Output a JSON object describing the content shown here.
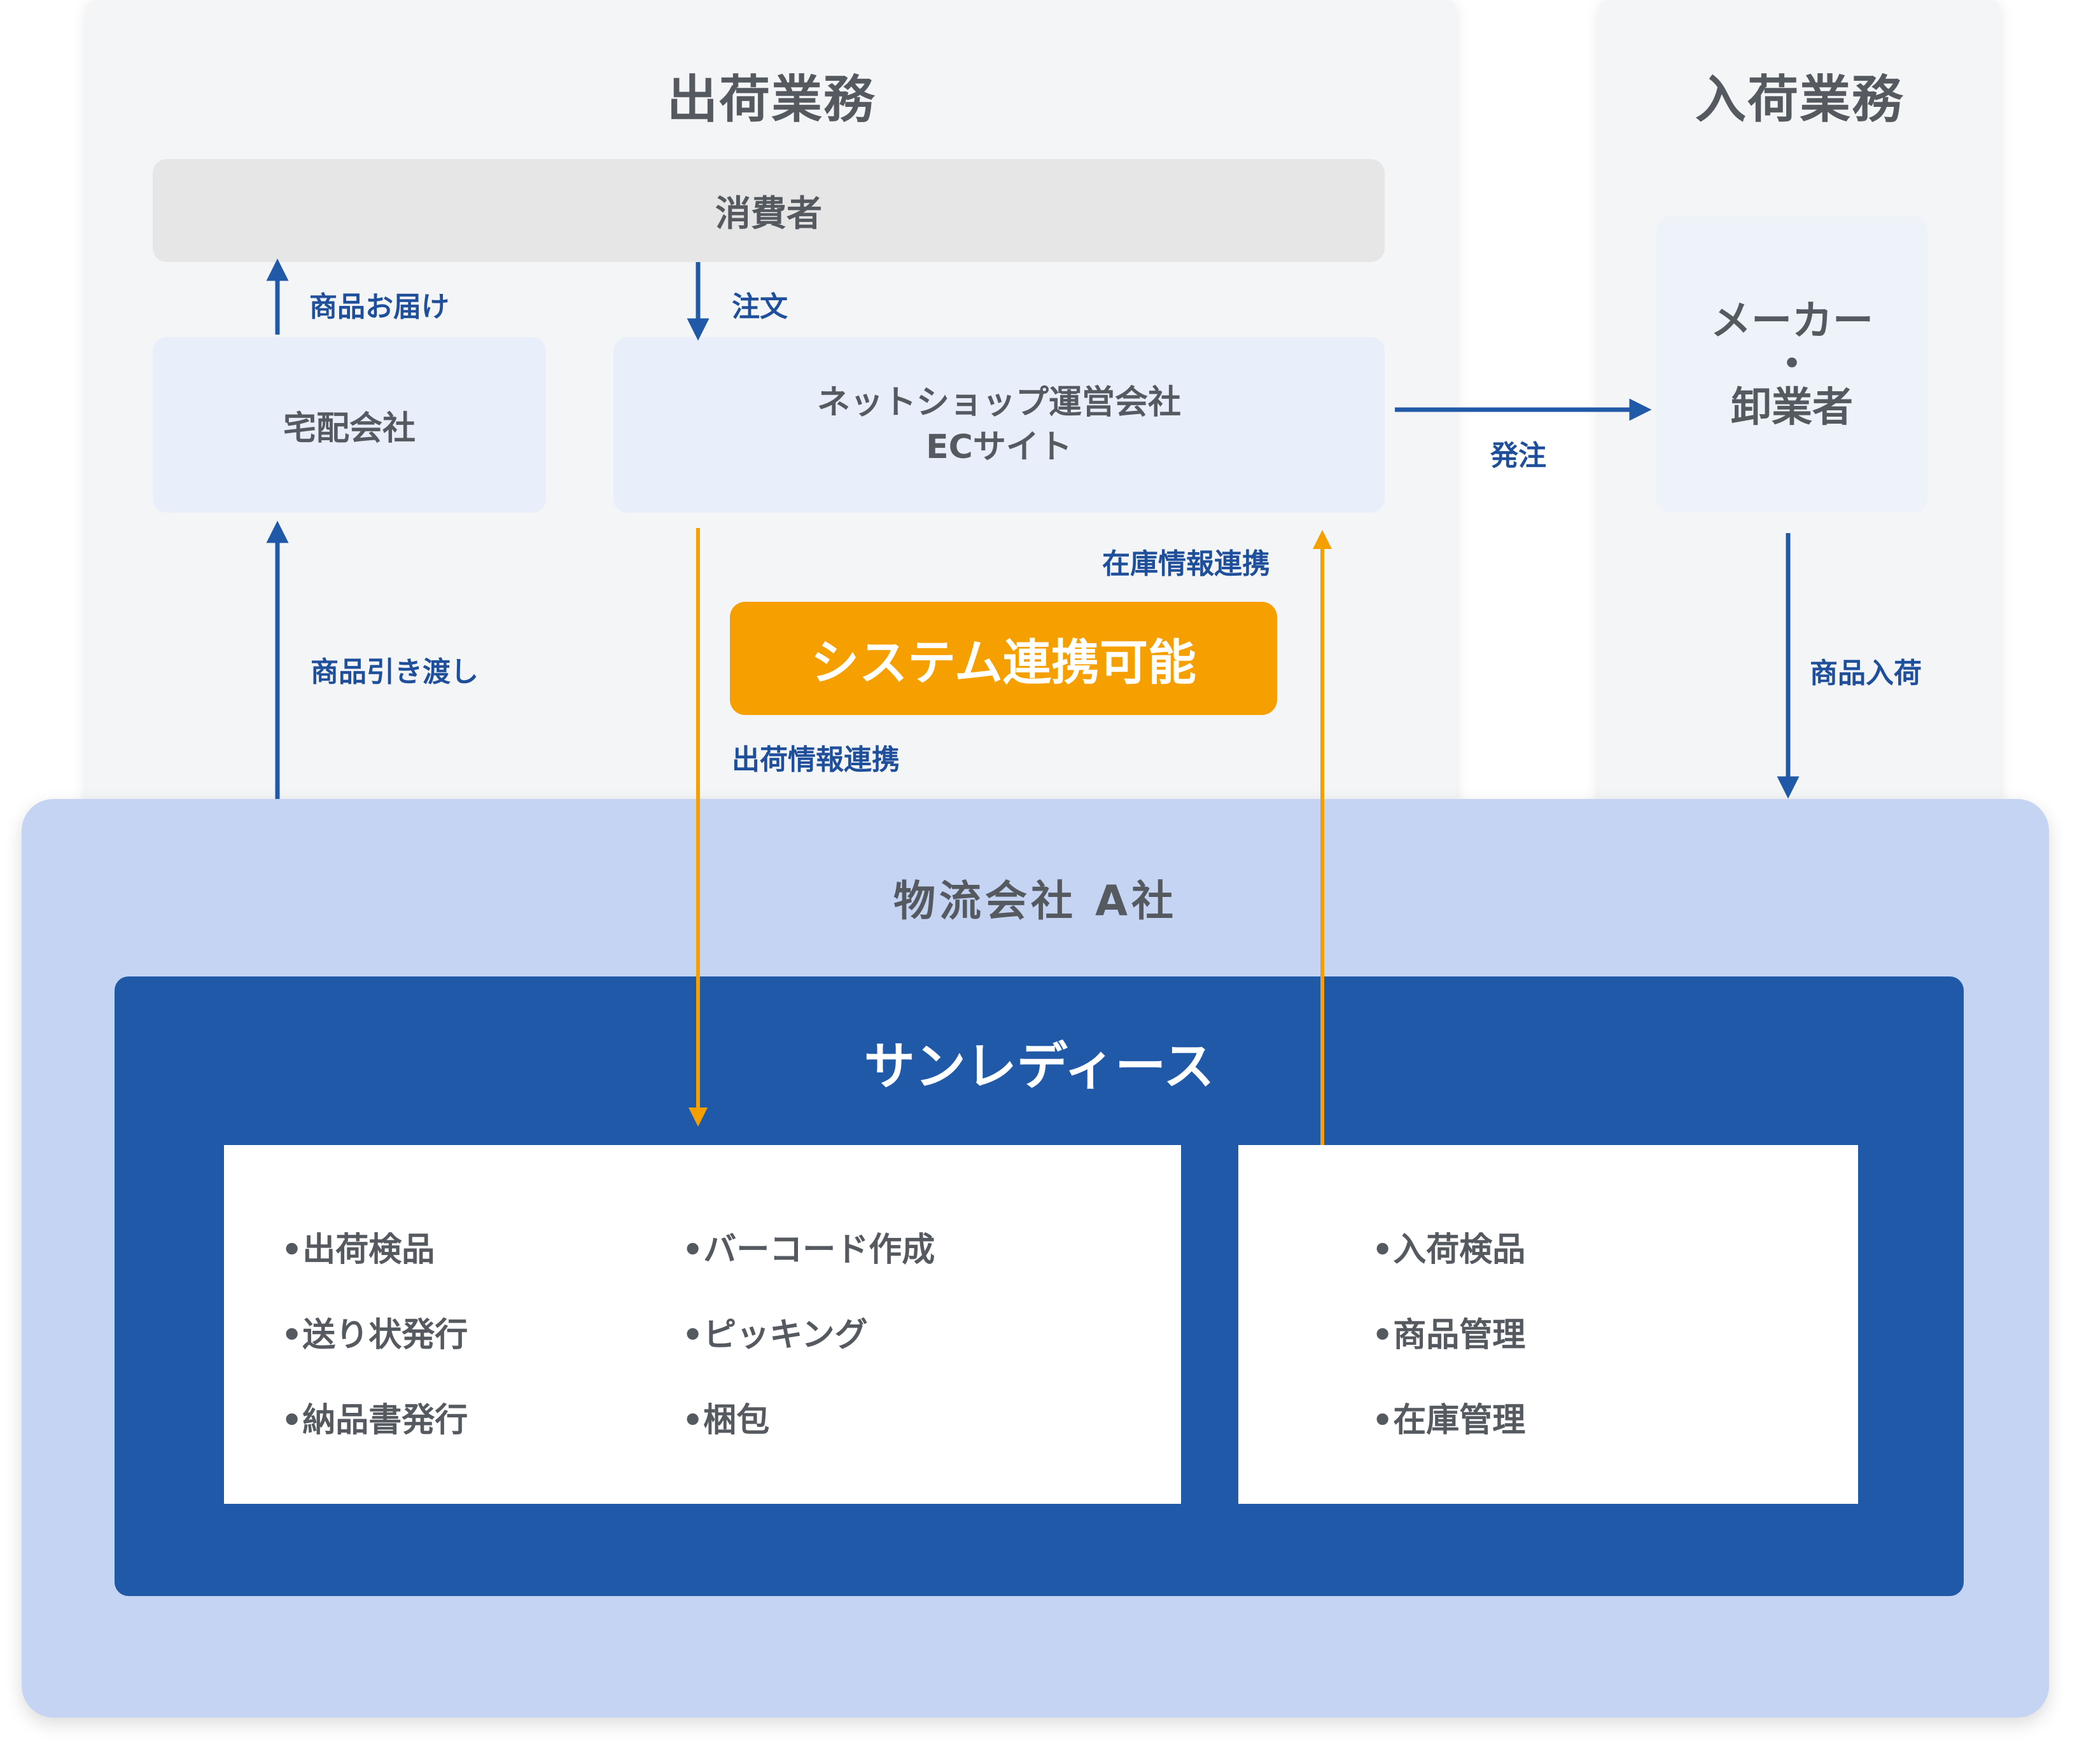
{
  "outbound": {
    "title": "出荷業務"
  },
  "inbound": {
    "title": "入荷業務"
  },
  "consumer": {
    "label": "消費者"
  },
  "courier": {
    "label": "宅配会社"
  },
  "shop": {
    "line1": "ネットショップ運営会社",
    "line2": "ECサイト"
  },
  "maker": {
    "line1": "メーカー",
    "dot": "・",
    "line2": "卸業者"
  },
  "labels": {
    "delivery": "商品お届け",
    "order": "注文",
    "purchase_order": "発注",
    "handover": "商品引き渡し",
    "stock_sync": "在庫情報連携",
    "shipping_sync": "出荷情報連携",
    "arrival": "商品入荷"
  },
  "system_badge": "システム連携可能",
  "logistics": {
    "title": "物流会社 A社"
  },
  "sunladys": {
    "title": "サンレディース",
    "outbound_col1": [
      "•出荷検品",
      "•送り状発行",
      "•納品書発行"
    ],
    "outbound_col2": [
      "•バーコード作成",
      "•ピッキング",
      "•梱包"
    ],
    "inbound_items": [
      "•入荷検品",
      "•商品管理",
      "•在庫管理"
    ]
  },
  "colors": {
    "blue_arrow": "#2059a8",
    "orange_arrow": "#f5a000",
    "label_blue": "#1f4f9a"
  }
}
